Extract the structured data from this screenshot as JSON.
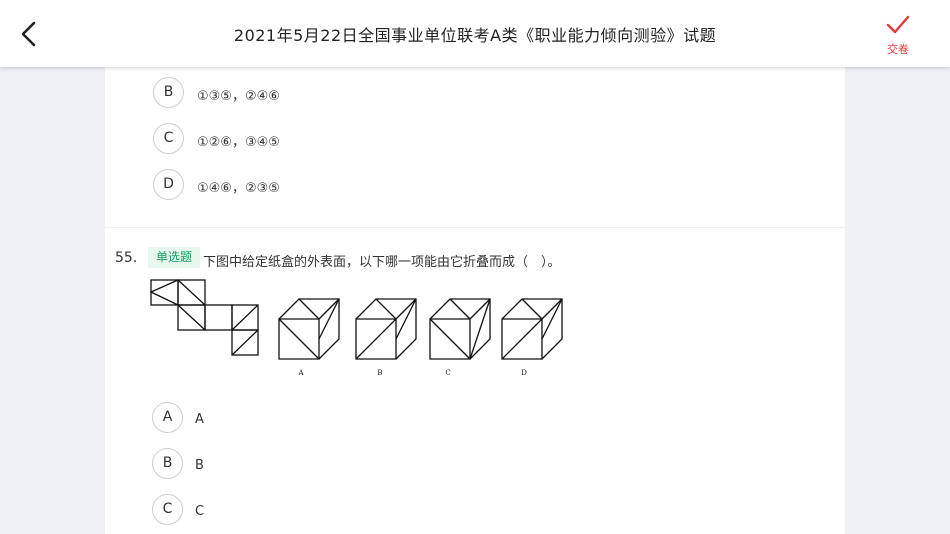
{
  "header": {
    "title": "2021年5月22日全国事业单位联考A类《职业能力倾向测验》试题",
    "submit_label": "交卷",
    "accent_color": "#e4393c"
  },
  "prev_question": {
    "options": [
      {
        "letter": "B",
        "text": "①③⑤，②④⑥"
      },
      {
        "letter": "C",
        "text": "①②⑥，③④⑤"
      },
      {
        "letter": "D",
        "text": "①④⑥，②③⑤"
      }
    ]
  },
  "question": {
    "number": "55.",
    "type_tag": "单选题",
    "stem": "下图中给定纸盒的外表面，以下哪一项能由它折叠而成（　）。",
    "figure_labels": [
      "A",
      "B",
      "C",
      "D"
    ],
    "options": [
      {
        "letter": "A",
        "text": "A"
      },
      {
        "letter": "B",
        "text": "B"
      },
      {
        "letter": "C",
        "text": "C"
      }
    ]
  }
}
